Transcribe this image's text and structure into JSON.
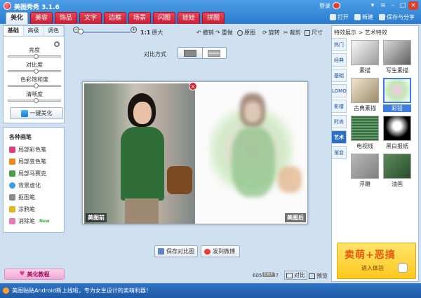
{
  "app": {
    "title": "美图秀秀 3.1.6",
    "login": "登录"
  },
  "nav": {
    "tabs": [
      "美化",
      "美容",
      "饰品",
      "文字",
      "边框",
      "场景",
      "闪图",
      "娃娃",
      "拼图"
    ],
    "active": 0
  },
  "top_actions": {
    "open": "打开",
    "new": "新建",
    "save_share": "保存与分享"
  },
  "left": {
    "tabs": [
      "基础",
      "高级",
      "调色"
    ],
    "sliders": [
      {
        "label": "亮度",
        "value": 0.5
      },
      {
        "label": "对比度",
        "value": 0.5
      },
      {
        "label": "色彩饱和度",
        "value": 0.5
      },
      {
        "label": "清晰度",
        "value": 0.5
      }
    ],
    "auto_button": "一键美化",
    "brush_title": "各种画笔",
    "brushes": [
      {
        "label": "局部彩色笔",
        "color": "#e23b7a"
      },
      {
        "label": "局部变色笔",
        "color": "#f08a1c"
      },
      {
        "label": "局部马赛克",
        "color": "#42a04a"
      },
      {
        "label": "背景虚化",
        "color": "#3aa0e8"
      },
      {
        "label": "抠图笔",
        "color": "#8a8a8a"
      },
      {
        "label": "涂鸦笔",
        "color": "#e0b522"
      },
      {
        "label": "消除笔",
        "color": "#e27bb6",
        "badge": "New"
      }
    ],
    "tutorial": "美化教程"
  },
  "toolbar": {
    "zoom_label": "1:1",
    "original_size": "原大",
    "tools": [
      "撤销",
      "重做",
      "原图",
      "旋转",
      "裁剪",
      "尺寸"
    ]
  },
  "compare": {
    "label": "对比方式"
  },
  "photos": {
    "before": "美图前",
    "after": "美图后"
  },
  "buttons": {
    "save_compare": "保存对比图",
    "send_weibo": "发到微博"
  },
  "status": {
    "dims": "605 × 747",
    "exif": "EXIF",
    "compare_mode": "对比",
    "preview_mode": "预览"
  },
  "right": {
    "header": "特效展示 > 艺术特效",
    "categories": [
      "热门",
      "经典",
      "基础",
      "LOMO",
      "影楼",
      "时尚",
      "艺术",
      "渐变"
    ],
    "active_category": 6,
    "effects": [
      {
        "label": "素描"
      },
      {
        "label": "写生素描"
      },
      {
        "label": "古典素描"
      },
      {
        "label": "彩铅",
        "selected": true
      },
      {
        "label": "电视线"
      },
      {
        "label": "黑白报纸"
      },
      {
        "label": "浮雕"
      },
      {
        "label": "油画"
      }
    ],
    "ad": {
      "title": "卖萌+恶搞",
      "sub": "进入体验"
    }
  },
  "statusbar": {
    "message": "美图贴贴Android新上线啦，专为女生设计的卖萌利器！"
  }
}
